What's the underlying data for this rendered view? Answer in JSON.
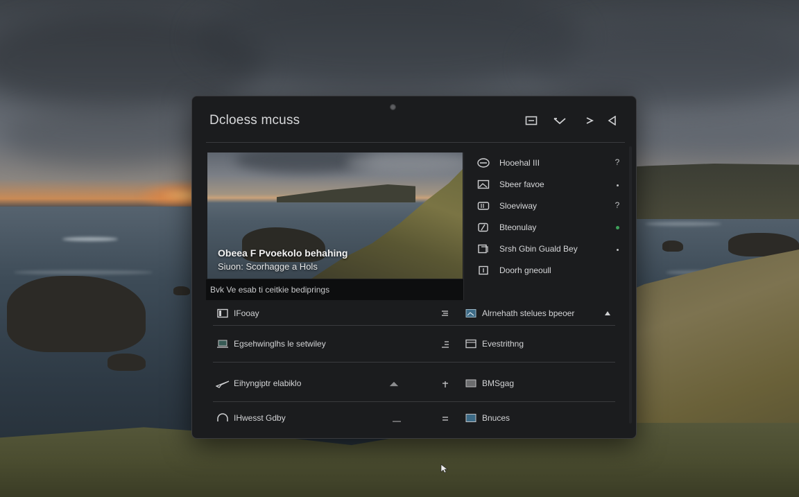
{
  "window": {
    "title": "Dcloess mcuss"
  },
  "titlebar_buttons": [
    {
      "icon": "window-icon"
    },
    {
      "icon": "undo-icon"
    },
    {
      "icon": "forward-icon"
    },
    {
      "icon": "back-icon"
    }
  ],
  "preview": {
    "caption_title": "Obeea F Pvoekolo behahing",
    "caption_sub": "Siuon: Scorhagge a Hols",
    "footer_text": "Bvk Ve esab ti ceitkie bediprings"
  },
  "side_list": [
    {
      "label": "Hooehal III",
      "icon": "compass-icon",
      "meta": "?"
    },
    {
      "label": "Sbeer favoe",
      "icon": "image-icon",
      "meta": "dot"
    },
    {
      "label": "Sloeviway",
      "icon": "folder-icon",
      "meta": "?"
    },
    {
      "label": "Bteonulay",
      "icon": "edit-icon",
      "meta": "green-dot"
    },
    {
      "label": "Srsh Gbin Guald Bey",
      "icon": "copy-icon",
      "meta": "dot"
    },
    {
      "label": "Doorh gneoull",
      "icon": "document-icon",
      "meta": ""
    }
  ],
  "rows": [
    {
      "left_label": "IFooay",
      "right_label": "Alrnehath stelues bpeoer",
      "left_icon": "monitor-icon",
      "mid_icon": "pen-icon",
      "right_icon": "photo-icon",
      "end_icon": "up-arrow-icon"
    },
    {
      "left_label": "Egsehwinglhs le setwiley",
      "right_label": "Evestrithng",
      "left_icon": "laptop-icon",
      "mid_icon": "list-icon",
      "right_icon": "panel-icon",
      "end_icon": ""
    },
    {
      "left_label": "Eihyngiptr elabiklo",
      "right_label": "BMSgag",
      "left_icon": "plane-icon",
      "mid_icon": "pin-icon",
      "right_icon": "box-icon",
      "end_icon": ""
    },
    {
      "left_label": "IHwesst Gdby",
      "right_label": "Bnuces",
      "left_icon": "headphones-icon",
      "mid_icon": "bars-icon",
      "right_icon": "square-icon",
      "end_icon": ""
    }
  ]
}
